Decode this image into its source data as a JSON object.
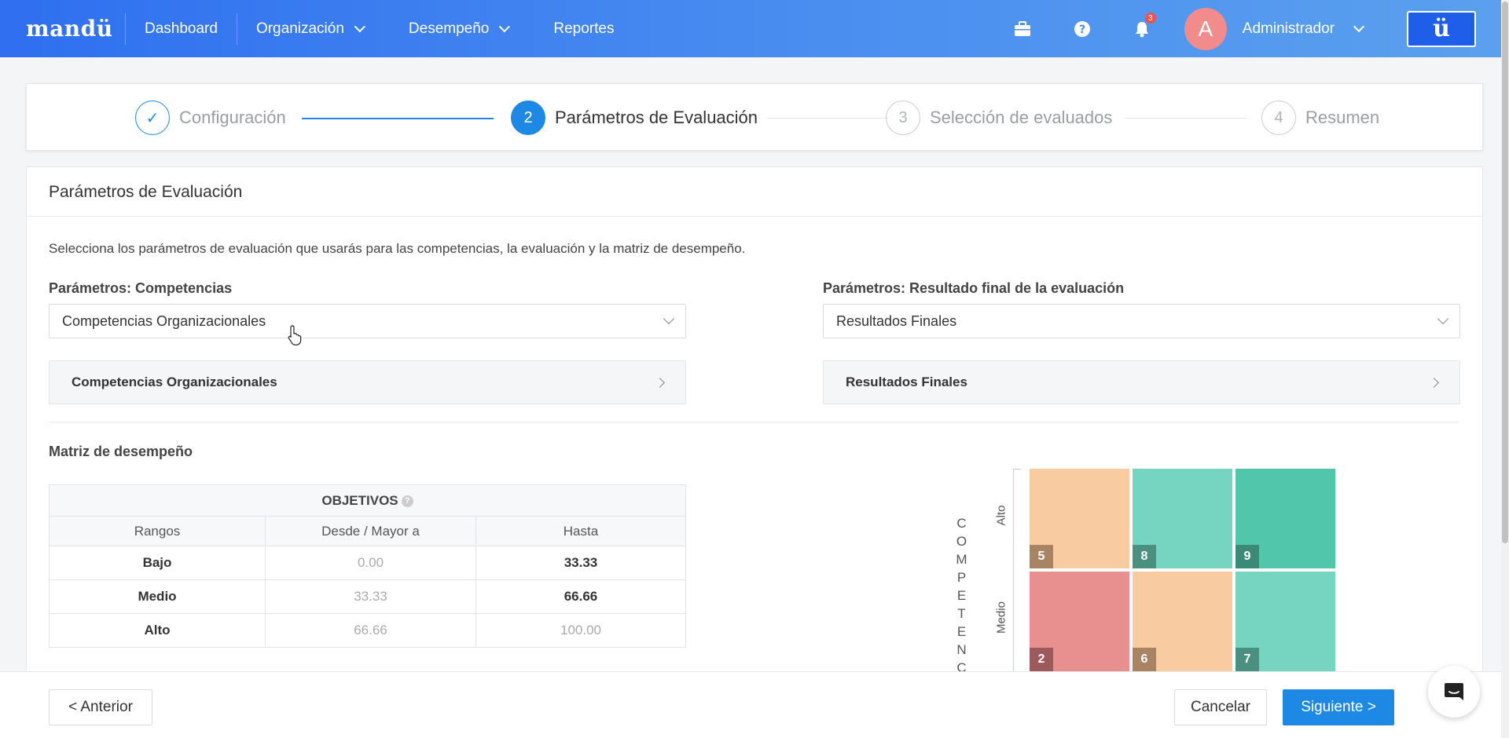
{
  "nav": {
    "logo": "mandü",
    "items": [
      {
        "label": "Dashboard"
      },
      {
        "label": "Organización"
      },
      {
        "label": "Desempeño"
      },
      {
        "label": "Reportes"
      }
    ],
    "notification_count": "3",
    "avatar_letter": "A",
    "user_name": "Administrador",
    "brand_button": "ü",
    "icons": [
      "briefcase-icon",
      "help-icon",
      "bell-icon"
    ]
  },
  "stepper": {
    "steps": [
      {
        "number": "✓",
        "label": "Configuración",
        "state": "done"
      },
      {
        "number": "2",
        "label": "Parámetros de Evaluación",
        "state": "active"
      },
      {
        "number": "3",
        "label": "Selección de evaluados",
        "state": "pending"
      },
      {
        "number": "4",
        "label": "Resumen",
        "state": "pending"
      }
    ]
  },
  "card": {
    "title": "Parámetros de Evaluación",
    "description": "Selecciona los parámetros de evaluación que usarás para las competencias, la evaluación y la matriz de desempeño.",
    "competencias": {
      "label": "Parámetros: Competencias",
      "selected": "Competencias Organizacionales",
      "panel": "Competencias Organizacionales"
    },
    "resultado": {
      "label": "Parámetros: Resultado final de la evaluación",
      "selected": "Resultados Finales",
      "panel": "Resultados Finales"
    },
    "matrix_title": "Matriz de desempeño"
  },
  "objetivos_table": {
    "title": "OBJETIVOS",
    "help": "?",
    "headers": [
      "Rangos",
      "Desde / Mayor a",
      "Hasta"
    ],
    "rows": [
      {
        "rango": "Bajo",
        "desde": "0.00",
        "hasta": "33.33"
      },
      {
        "rango": "Medio",
        "desde": "33.33",
        "hasta": "66.66"
      },
      {
        "rango": "Alto",
        "desde": "66.66",
        "hasta": "100.00"
      }
    ]
  },
  "matrix": {
    "vertical_title": "COMPETENC",
    "y_labels": {
      "top": "Alto",
      "middle": "Medio"
    },
    "colors": {
      "peach": "#f8cba0",
      "mint": "#76d5c0",
      "teal": "#52c6aa",
      "rose": "#e89090"
    },
    "cells": [
      {
        "value": "5",
        "color": "#f8cba0",
        "badge": "#a88364"
      },
      {
        "value": "8",
        "color": "#76d5c0",
        "badge": "#4a8f80"
      },
      {
        "value": "9",
        "color": "#52c6aa",
        "badge": "#3a8a77"
      },
      {
        "value": "2",
        "color": "#e89090",
        "badge": "#9c5a5a"
      },
      {
        "value": "6",
        "color": "#f8cba0",
        "badge": "#a88364"
      },
      {
        "value": "7",
        "color": "#76d5c0",
        "badge": "#4a8f80"
      }
    ]
  },
  "footer": {
    "prev": "< Anterior",
    "cancel": "Cancelar",
    "next": "Siguiente >"
  }
}
